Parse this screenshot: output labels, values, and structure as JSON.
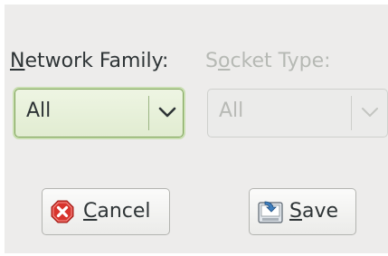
{
  "network_family": {
    "label_mnemonic": "N",
    "label_rest": "etwork Family:",
    "selected": "All"
  },
  "socket_type": {
    "label_pre": "S",
    "label_mnemonic": "o",
    "label_rest": "cket Type:",
    "selected": "All",
    "state": "disabled"
  },
  "buttons": {
    "cancel": {
      "mnemonic": "C",
      "rest": "ancel",
      "icon": "cancel-icon"
    },
    "save": {
      "mnemonic": "S",
      "rest": "ave",
      "icon": "save-icon"
    }
  },
  "colors": {
    "background": "#edeceb",
    "active_combo_border": "#7fa35a",
    "cancel_icon": "#d8342d",
    "save_icon": "#3f7fbf"
  }
}
